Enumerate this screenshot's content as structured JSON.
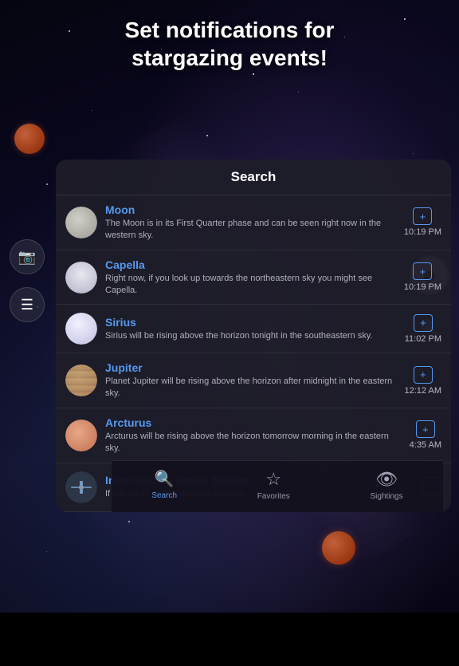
{
  "header": {
    "title": "Set notifications for\nstargazing events!"
  },
  "search_panel": {
    "title": "Search",
    "items": [
      {
        "name": "Moon",
        "description": "The Moon is in its First Quarter phase and can be seen right now in the western sky.",
        "time": "10:19 PM",
        "icon_type": "moon"
      },
      {
        "name": "Capella",
        "description": "Right now, if you look up towards the northeastern sky you might see Capella.",
        "time": "10:19 PM",
        "icon_type": "capella"
      },
      {
        "name": "Sirius",
        "description": "Sirius will be rising above the horizon tonight in the southeastern sky.",
        "time": "11:02 PM",
        "icon_type": "sirius"
      },
      {
        "name": "Jupiter",
        "description": "Planet Jupiter will be rising above the horizon after midnight in the eastern sky.",
        "time": "12:12 AM",
        "icon_type": "jupiter"
      },
      {
        "name": "Arcturus",
        "description": "Arcturus will be rising above the horizon tomorrow morning in the eastern sky.",
        "time": "4:35 AM",
        "icon_type": "arcturus"
      },
      {
        "name": "International Space Station",
        "description": "If the sky is clear tomorrow morning,",
        "time": "",
        "icon_type": "iss"
      }
    ]
  },
  "sidebar": {
    "camera_label": "📷",
    "menu_label": "☰"
  },
  "right_sidebar": {
    "circle_label": "⬤",
    "search_label": "🔍"
  },
  "bottom_nav": {
    "items": [
      {
        "label": "Search",
        "icon": "🔍",
        "active": true
      },
      {
        "label": "Favorites",
        "icon": "☆",
        "active": false
      },
      {
        "label": "Sightings",
        "icon": "👁",
        "active": false
      }
    ]
  }
}
